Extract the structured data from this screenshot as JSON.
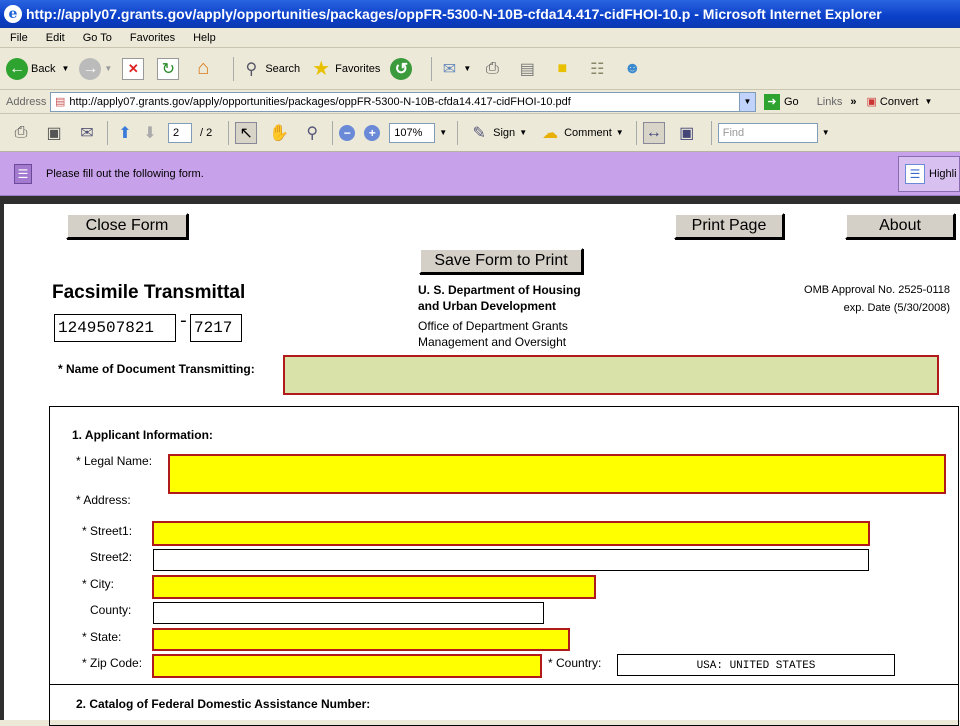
{
  "window": {
    "title": "http://apply07.grants.gov/apply/opportunities/packages/oppFR-5300-N-10B-cfda14.417-cidFHOI-10.p - Microsoft Internet Explorer"
  },
  "menu": [
    "File",
    "Edit",
    "Go To",
    "Favorites",
    "Help"
  ],
  "toolbar": {
    "back": "Back",
    "search": "Search",
    "favorites": "Favorites"
  },
  "address": {
    "label": "Address",
    "url": "http://apply07.grants.gov/apply/opportunities/packages/oppFR-5300-N-10B-cfda14.417-cidFHOI-10.pdf",
    "go": "Go",
    "links": "Links",
    "convert": "Convert"
  },
  "pdf": {
    "page_current": "2",
    "page_total": "/ 2",
    "zoom": "107%",
    "sign": "Sign",
    "comment": "Comment",
    "find_placeholder": "Find"
  },
  "formbar": {
    "message": "Please fill out the following form.",
    "highlight": "Highli"
  },
  "form": {
    "close_btn": "Close Form",
    "print_btn": "Print Page",
    "about_btn": "About",
    "save_btn": "Save Form to Print",
    "title": "Facsimile Transmittal",
    "id_main": "1249507821",
    "id_dash": "-",
    "id_suffix": "7217",
    "agency_line1": "U. S. Department of Housing",
    "agency_line2": "and Urban Development",
    "office_line1": "Office of Department Grants",
    "office_line2": "Management and Oversight",
    "omb": "OMB Approval No. 2525-0118",
    "exp": "exp. Date (5/30/2008)",
    "doc_name_label": "* Name of Document Transmitting:",
    "section1": "1. Applicant Information:",
    "legal_name_label": "* Legal Name:",
    "address_label": "* Address:",
    "street1_label": "* Street1:",
    "street2_label": "Street2:",
    "city_label": "* City:",
    "county_label": "County:",
    "state_label": "* State:",
    "zip_label": "* Zip Code:",
    "country_label": "* Country:",
    "country_value": "USA: UNITED STATES",
    "section2": "2. Catalog of Federal Domestic Assistance Number:"
  },
  "colors": {
    "required_fill": "#ffff00",
    "required_border": "#b01a1a",
    "doc_name_fill": "#d9e3a9",
    "formbar_bg": "#c7a2ea"
  }
}
